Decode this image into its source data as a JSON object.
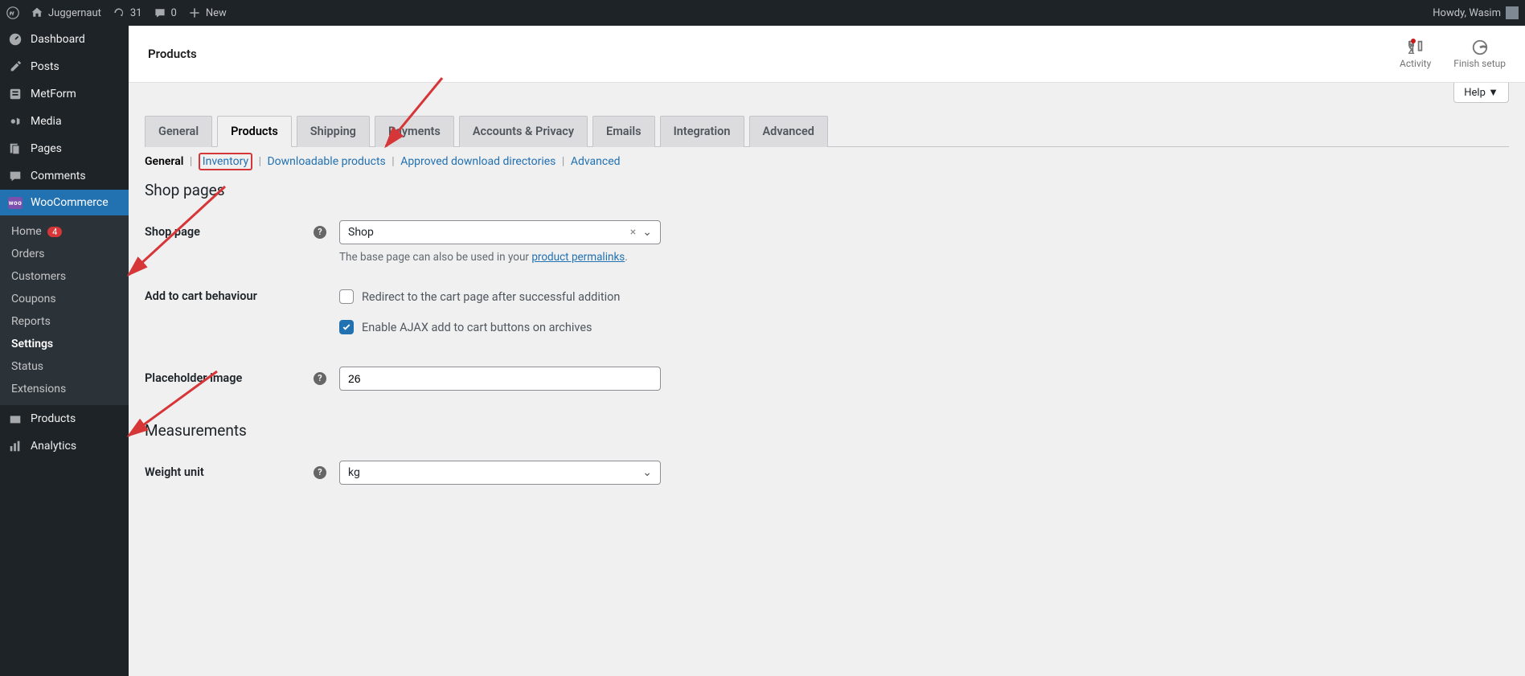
{
  "adminbar": {
    "site_title": "Juggernaut",
    "updates": "31",
    "comments": "0",
    "new_label": "New",
    "greeting": "Howdy, Wasim"
  },
  "sidebar": {
    "items": [
      {
        "label": "Dashboard",
        "icon": "dashboard"
      },
      {
        "label": "Posts",
        "icon": "pin"
      },
      {
        "label": "MetForm",
        "icon": "form"
      },
      {
        "label": "Media",
        "icon": "media"
      },
      {
        "label": "Pages",
        "icon": "pages"
      },
      {
        "label": "Comments",
        "icon": "comments"
      }
    ],
    "woocommerce": "WooCommerce",
    "submenu": [
      {
        "label": "Home",
        "badge": "4"
      },
      {
        "label": "Orders"
      },
      {
        "label": "Customers"
      },
      {
        "label": "Coupons"
      },
      {
        "label": "Reports"
      },
      {
        "label": "Settings",
        "current": true
      },
      {
        "label": "Status"
      },
      {
        "label": "Extensions"
      }
    ],
    "products": "Products",
    "analytics": "Analytics"
  },
  "header": {
    "title": "Products",
    "activity": "Activity",
    "finish_setup": "Finish setup"
  },
  "help_btn": "Help ▼",
  "tabs": [
    "General",
    "Products",
    "Shipping",
    "Payments",
    "Accounts & Privacy",
    "Emails",
    "Integration",
    "Advanced"
  ],
  "subtabs": {
    "general": "General",
    "inventory": "Inventory",
    "downloadable": "Downloadable products",
    "approved": "Approved download directories",
    "advanced": "Advanced"
  },
  "sections": {
    "shop_pages": "Shop pages",
    "measurements": "Measurements"
  },
  "fields": {
    "shop_page": {
      "label": "Shop page",
      "value": "Shop",
      "desc_pre": "The base page can also be used in your ",
      "desc_link": "product permalinks",
      "desc_post": "."
    },
    "add_to_cart": {
      "label": "Add to cart behaviour",
      "opt1": "Redirect to the cart page after successful addition",
      "opt2": "Enable AJAX add to cart buttons on archives"
    },
    "placeholder_image": {
      "label": "Placeholder image",
      "value": "26"
    },
    "weight_unit": {
      "label": "Weight unit",
      "value": "kg"
    }
  }
}
